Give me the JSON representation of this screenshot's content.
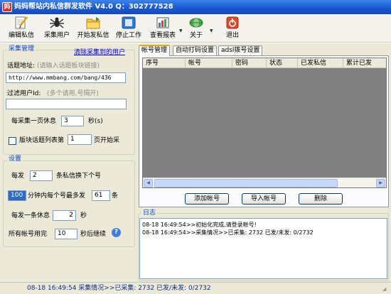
{
  "window": {
    "title": "妈妈帮站内私信群发软件  V4.0 Q：302777528",
    "icon_char": "妈"
  },
  "toolbar": {
    "items": [
      {
        "label": "编辑私信",
        "icon": "edit-icon"
      },
      {
        "label": "采集用户",
        "icon": "spider-icon"
      },
      {
        "label": "开始发私信",
        "icon": "folder-icon"
      },
      {
        "label": "停止工作",
        "icon": "stop-icon"
      },
      {
        "label": "查看报表",
        "icon": "report-icon"
      },
      {
        "label": "关于",
        "icon": "about-icon"
      },
      {
        "label": "退出",
        "icon": "exit-icon"
      }
    ]
  },
  "collect": {
    "title": "采集管理",
    "clear_link": "清除采集到的用户",
    "topic_label": "话题地址:",
    "topic_hint": "(请输入话题板块链接)",
    "topic_value": "http://www.mmbang.com/bang/436",
    "filter_label": "过滤用户Id:",
    "filter_hint": "(多个请用,号隔开)",
    "filter_value": "",
    "page_rest_prefix": "每采集一页休息",
    "page_rest_value": "3",
    "page_rest_suffix": "秒(s)",
    "start_page_label": "版块话题列表第",
    "start_page_value": "1",
    "start_page_suffix": "页开始采"
  },
  "settings": {
    "title": "设置",
    "per_send_prefix": "每发",
    "per_send_value": "2",
    "per_send_suffix": "条私信换下个号",
    "minutes_value": "100",
    "minutes_mid": "分钟内每个号最多发",
    "max_value": "61",
    "max_suffix": "条",
    "rest_prefix": "每发一条休息",
    "rest_value": "2",
    "rest_suffix": "秒",
    "all_used_prefix": "所有帐号用完",
    "all_used_value": "10",
    "all_used_suffix": "秒后继续"
  },
  "tabs": [
    "帐号管理",
    "自动打码设置",
    "adsl拨号设置"
  ],
  "accounts": {
    "columns": [
      "序号",
      "帐号",
      "密码",
      "状态",
      "已发私信",
      "累计已发"
    ],
    "rows": [],
    "buttons": [
      "添加帐号",
      "导入帐号",
      "删除"
    ]
  },
  "log": {
    "title": "日志",
    "lines": [
      "08-18 16:49:54>>初始化完成,请登录帐号!",
      "08-18 16:49:54>>采集情况>>已采集: 2732 已发/未发: 0/2732"
    ]
  },
  "status": {
    "text": "08-18 16:49:54 采集情况>>已采集: 2732 已发/未发: 0/2732"
  }
}
